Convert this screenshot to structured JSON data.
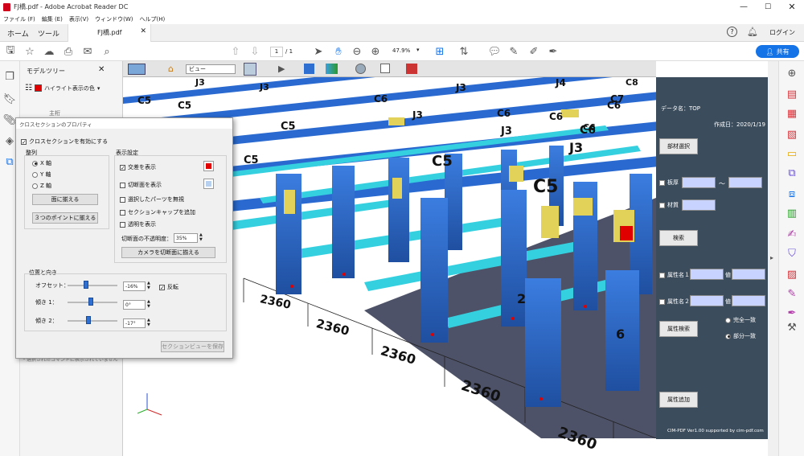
{
  "window": {
    "title": "FJ橋.pdf - Adobe Acrobat Reader DC"
  },
  "menu": [
    "ファイル (F)",
    "編集 (E)",
    "表示(V)",
    "ウィンドウ(W)",
    "ヘルプ(H)"
  ],
  "tabs": {
    "home": "ホーム",
    "tools": "ツール",
    "doc": "FJ橋.pdf"
  },
  "header": {
    "login": "ログイン",
    "share": "共有"
  },
  "toolbar": {
    "page_current": "1",
    "page_total": "/ 1",
    "zoom": "47.9%"
  },
  "model_tree": {
    "title": "モデルツリー",
    "highlight": "ハイライト表示の色",
    "item_main": "主桁"
  },
  "toolbar3d": {
    "view_select": "ビュー"
  },
  "dialog": {
    "title": "クロスセクションのプロパティ",
    "enable": "クロスセクションを有効にする",
    "align_title": "整列",
    "axis_x": "X 軸",
    "axis_y": "Y 軸",
    "axis_z": "Z 軸",
    "align_face": "面に揃える",
    "align_3pt": "３つのポイントに揃える",
    "display_title": "表示設定",
    "show_intersection": "交差を表示",
    "show_cut_plane": "切断面を表示",
    "ignore_selected": "選択したパーツを無視",
    "add_caps": "セクションキャップを追加",
    "show_transparent": "透明を表示",
    "opacity_label": "切断面の不透明度：",
    "opacity_value": "35%",
    "align_camera": "カメラを切断面に揃える",
    "position_title": "位置と向き",
    "offset_label": "オフセット：",
    "offset_value": "-16%",
    "flip": "反転",
    "tilt1_label": "傾き 1：",
    "tilt1_value": "0°",
    "tilt2_label": "傾き 2：",
    "tilt2_value": "-17°",
    "save_view": "セクションビューを保存",
    "hidden_text": "・選択されたコマンドに表示されていません"
  },
  "side_panel": {
    "data_name": "データ名：TOP",
    "created": "作成日：2020/1/19",
    "member_select": "部材選択",
    "thickness": "板厚",
    "tilde": "～",
    "material": "材質",
    "search": "検索",
    "attr1": "属性名１",
    "attr2": "属性名２",
    "value": "値",
    "exact": "完全一致",
    "partial": "部分一致",
    "attr_search": "属性検索",
    "attr_add": "属性追加",
    "footer": "CIM-PDF Ver1.00 supported by cim-pdf.com"
  },
  "scene": {
    "labels": [
      "C5",
      "C5",
      "C5",
      "C5",
      "C5",
      "C6",
      "C6",
      "C6",
      "C6",
      "C7",
      "C8",
      "J3",
      "J3",
      "J3",
      "J3",
      "J4",
      "J3",
      "J3",
      "C5",
      "C6",
      "C6"
    ],
    "dimensions": [
      "2360",
      "2360",
      "2360",
      "2360",
      "2360",
      "2360"
    ],
    "partial_labels": [
      "2",
      "6",
      "2"
    ]
  },
  "colors": {
    "accent": "#1473e6",
    "panel": "#3b4c5c",
    "girder": "#2f6fd1",
    "bracing": "#35d0e0",
    "splice": "#e2d25a",
    "highlight": "#e00000"
  }
}
